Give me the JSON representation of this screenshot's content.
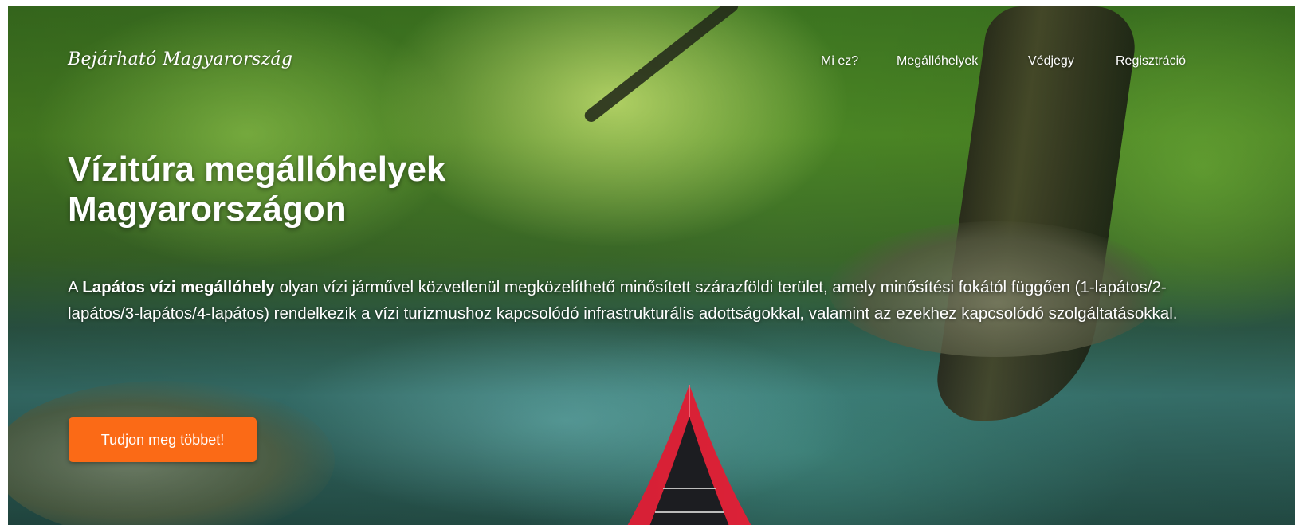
{
  "header": {
    "brand": "Bejárható Magyarország",
    "nav": [
      {
        "label": "Mi ez?"
      },
      {
        "label": "Megállóhelyek"
      },
      {
        "label": "Védjegy"
      },
      {
        "label": "Regisztráció"
      }
    ]
  },
  "hero": {
    "headline": "Vízitúra megállóhelyek Magyarországon",
    "description_prefix": "A ",
    "description_bold": "Lapátos vízi megállóhely",
    "description_rest": " olyan vízi járművel közvetlenül megközelíthető minősített szárazföldi terület, amely minősítési fokától függően (1-lapátos/2-lapátos/3-lapátos/4-lapátos) rendelkezik a vízi turizmushoz kapcsolódó infrastrukturális adottságokkal, valamint az ezekhez kapcsolódó szolgáltatásokkal.",
    "cta_label": "Tudjon meg többet!",
    "background_image": "forest-river-kayak-photo"
  },
  "colors": {
    "cta": "#fb6a16",
    "text": "#ffffff"
  }
}
